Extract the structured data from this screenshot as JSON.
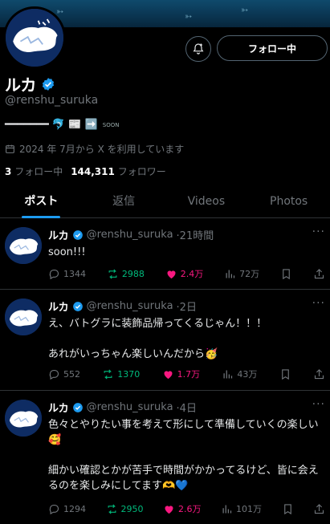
{
  "profile": {
    "follow_button": "フォロー中",
    "name": "ルカ",
    "handle": "@renshu_suruka",
    "bio_text": "━━━━━━━ 🐬 📰 ➡️",
    "bio_soon": "SOON",
    "joined": "2024 年 7月から X を利用しています",
    "following_count": "3",
    "following_label": "フォロー中",
    "followers_count": "144,311",
    "followers_label": "フォロワー"
  },
  "tabs": [
    {
      "label": "ポスト"
    },
    {
      "label": "返信"
    },
    {
      "label": "Videos"
    },
    {
      "label": "Photos"
    }
  ],
  "posts": [
    {
      "name": "ルカ",
      "handle": "@renshu_suruka",
      "time": "·21時間",
      "text": "soon!!!",
      "replies": "1344",
      "reposts": "2988",
      "likes": "2.4万",
      "views": "72万"
    },
    {
      "name": "ルカ",
      "handle": "@renshu_suruka",
      "time": "·2日",
      "text": "え、バトグラに装飾品帰ってくるじゃん！！！\n\nあれがいっちゃん楽しいんだから🥳",
      "replies": "552",
      "reposts": "1370",
      "likes": "1.7万",
      "views": "43万"
    },
    {
      "name": "ルカ",
      "handle": "@renshu_suruka",
      "time": "·4日",
      "text": "色々とやりたい事を考えて形にして準備していくの楽しい🥰\n\n細かい確認とかが苦手で時間がかかってるけど、皆に会えるのを楽しみにしてます🫶💙",
      "replies": "1294",
      "reposts": "2950",
      "likes": "2.6万",
      "views": "101万"
    }
  ],
  "colors": {
    "accent": "#1d9bf0",
    "repost": "#00ba7c",
    "like": "#f91880",
    "muted": "#71767b",
    "border": "#2f3336"
  }
}
